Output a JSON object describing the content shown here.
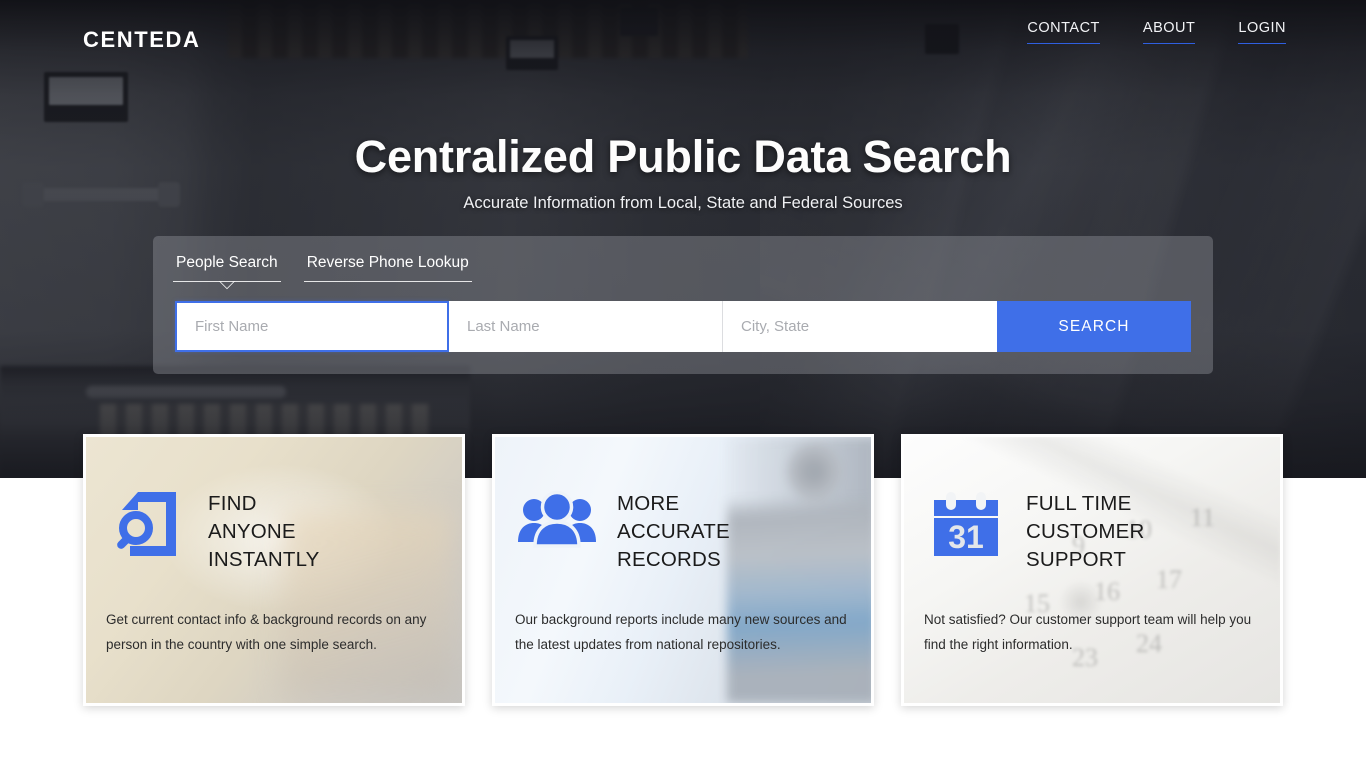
{
  "brand": {
    "name": "CENTEDA"
  },
  "nav": {
    "items": [
      {
        "label": "CONTACT",
        "name": "nav-contact"
      },
      {
        "label": "ABOUT",
        "name": "nav-about"
      },
      {
        "label": "LOGIN",
        "name": "nav-login"
      }
    ],
    "accent": "#2f5fe0"
  },
  "hero": {
    "title": "Centralized Public Data Search",
    "subtitle": "Accurate Information from Local, State and Federal Sources"
  },
  "search": {
    "tabs": [
      {
        "label": "People Search",
        "active": true
      },
      {
        "label": "Reverse Phone Lookup",
        "active": false
      }
    ],
    "fields": {
      "first_name": {
        "placeholder": "First Name",
        "value": ""
      },
      "last_name": {
        "placeholder": "Last Name",
        "value": ""
      },
      "city_state": {
        "placeholder": "City, State",
        "value": ""
      }
    },
    "button_label": "SEARCH",
    "button_color": "#3f6fe8"
  },
  "cards": [
    {
      "icon": "document-search-icon",
      "title": "FIND\nANYONE\nINSTANTLY",
      "text": "Get current contact info & background records on any person in the country with one simple search.",
      "icon_color": "#3f6fe8"
    },
    {
      "icon": "people-group-icon",
      "title": "MORE\nACCURATE\nRECORDS",
      "text": "Our background reports include many new sources and the latest updates from national repositories.",
      "icon_color": "#3f6fe8"
    },
    {
      "icon": "calendar-icon",
      "title": "FULL TIME\nCUSTOMER\nSUPPORT",
      "text": "Not satisfied? Our customer support team will help you find the right information.",
      "icon_color": "#3f6fe8",
      "calendar_day": "31"
    }
  ]
}
